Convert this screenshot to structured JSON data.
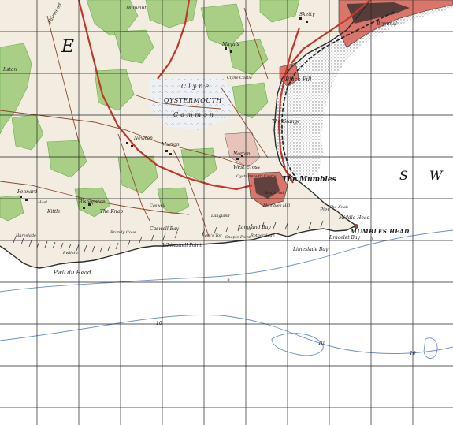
{
  "map": {
    "grid_letters": {
      "west": "E",
      "east_s": "S",
      "east_w": "W"
    },
    "places": {
      "mumbles": "The Mumbles",
      "mumbles_head": "MUMBLES HEAD",
      "oystermouth": "OYSTERMOUTH",
      "clyne_common": "Clyne",
      "clyne_common_2": "Common",
      "pwll_du_head": "Pwll du Head",
      "whiteshell_point": "Whiteshell Point",
      "bracelet_bay": "Bracelet Bay",
      "limeslade_bay": "Limeslade Bay",
      "langland_bay": "Langland Bay",
      "rotherslade": "Rotherslade",
      "caswell_bay": "Caswell Bay",
      "the_knap": "The Knap",
      "blackpill": "Black Pill",
      "the_grange": "The Grange",
      "west_cross": "West Cross",
      "norton": "Norton",
      "newton": "Newton",
      "murton": "Murton",
      "bishopston": "Bishopston",
      "the_mumbles_pier": "Pier",
      "high_pennard": "Pennard",
      "kittle": "Kittle",
      "mayals": "Mayals",
      "brynmill": "Brynmill",
      "sketty": "Sketty",
      "dunvant": "Dunvant",
      "ilston": "Ilston",
      "fairwood": "Fairwood",
      "middle_head": "Middle Head",
      "snaple_point": "Snaple Point",
      "rams_tor": "Ram's Tor",
      "the_knab": "The Knab",
      "hareslade": "Hareslade",
      "the_ring": "Hael",
      "bracelet": "Bracelet",
      "high_tor": "Mumbles Hill",
      "oystermouth_castle": "Oystermouth Castle",
      "clyne_castle": "Clyne Castle",
      "southend": "Southend",
      "langland": "Langland",
      "caswell": "Caswell",
      "brandy_cove": "Brandy Cove",
      "pwll_du": "Pwll du"
    },
    "depth_labels": [
      "5",
      "5",
      "10",
      "10",
      "10",
      "5"
    ],
    "colors": {
      "sea": "#ffffff",
      "land": "#f3ece1",
      "woodland": "#a9cf86",
      "woodland_dark": "#6aa84f",
      "urban": "#d9756a",
      "urban_dark": "#2b2b2b",
      "roads_main": "#c0392b",
      "roads_minor": "#8b4a2b",
      "coast_line": "#2d2d2d",
      "sand": "#d9d9d9",
      "depth_contour": "#6d8fc7",
      "grid": "#222222",
      "railway": "#222222"
    }
  }
}
